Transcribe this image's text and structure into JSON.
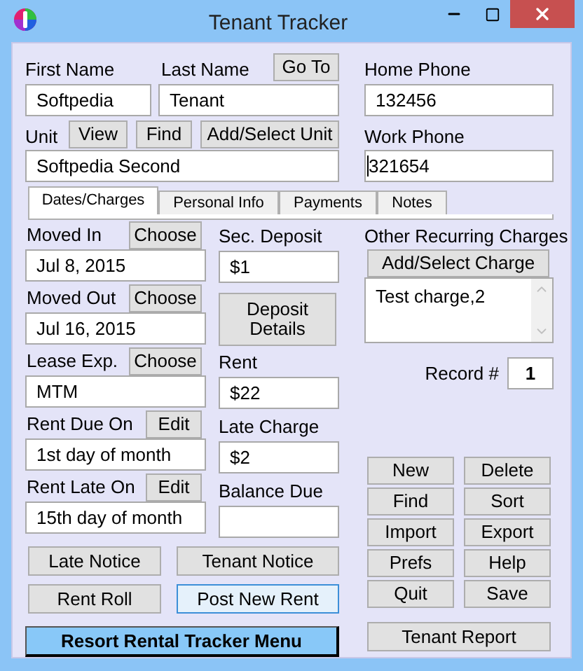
{
  "window": {
    "title": "Tenant Tracker"
  },
  "header": {
    "first_name": {
      "label": "First Name",
      "value": "Softpedia"
    },
    "last_name": {
      "label": "Last Name",
      "value": "Tenant"
    },
    "goto_button": "Go To",
    "home_phone": {
      "label": "Home Phone",
      "value": "132456"
    },
    "unit": {
      "label": "Unit",
      "value": "Softpedia Second",
      "buttons": [
        "View",
        "Find",
        "Add/Select Unit"
      ]
    },
    "work_phone": {
      "label": "Work Phone",
      "value": "321654",
      "focused": true
    }
  },
  "tabs": [
    {
      "label": "Dates/Charges",
      "selected": true
    },
    {
      "label": "Personal Info",
      "selected": false
    },
    {
      "label": "Payments",
      "selected": false
    },
    {
      "label": "Notes",
      "selected": false
    }
  ],
  "dates": [
    {
      "label": "Moved In",
      "button": "Choose",
      "value": "Jul 8, 2015"
    },
    {
      "label": "Moved Out",
      "button": "Choose",
      "value": "Jul 16, 2015"
    },
    {
      "label": "Lease Exp.",
      "button": "Choose",
      "value": "MTM"
    },
    {
      "label": "Rent Due On",
      "button": "Edit",
      "value": "1st day of month"
    },
    {
      "label": "Rent Late On",
      "button": "Edit",
      "value": "15th day of month"
    }
  ],
  "amounts": [
    {
      "label": "Sec. Deposit",
      "value": "$1"
    },
    {
      "label": "Rent",
      "value": "$22"
    },
    {
      "label": "Late Charge",
      "value": "$2"
    },
    {
      "label": "Balance Due"
    }
  ],
  "deposit_button": "Deposit Details",
  "other_charges": {
    "label": "Other Recurring Charges",
    "button": "Add/Select Charge",
    "items": [
      "Test charge,2"
    ]
  },
  "record": {
    "label": "Record #",
    "value": "1"
  },
  "notice_buttons": [
    {
      "label": "Late Notice",
      "focused": false
    },
    {
      "label": "Tenant Notice",
      "focused": false
    },
    {
      "label": "Rent Roll",
      "focused": false
    },
    {
      "label": "Post New Rent",
      "focused": true
    }
  ],
  "menu_button": "Resort Rental Tracker Menu",
  "actions": [
    "New",
    "Delete",
    "Find",
    "Sort",
    "Import",
    "Export",
    "Prefs",
    "Help",
    "Quit",
    "Save"
  ],
  "report_button": "Tenant Report"
}
